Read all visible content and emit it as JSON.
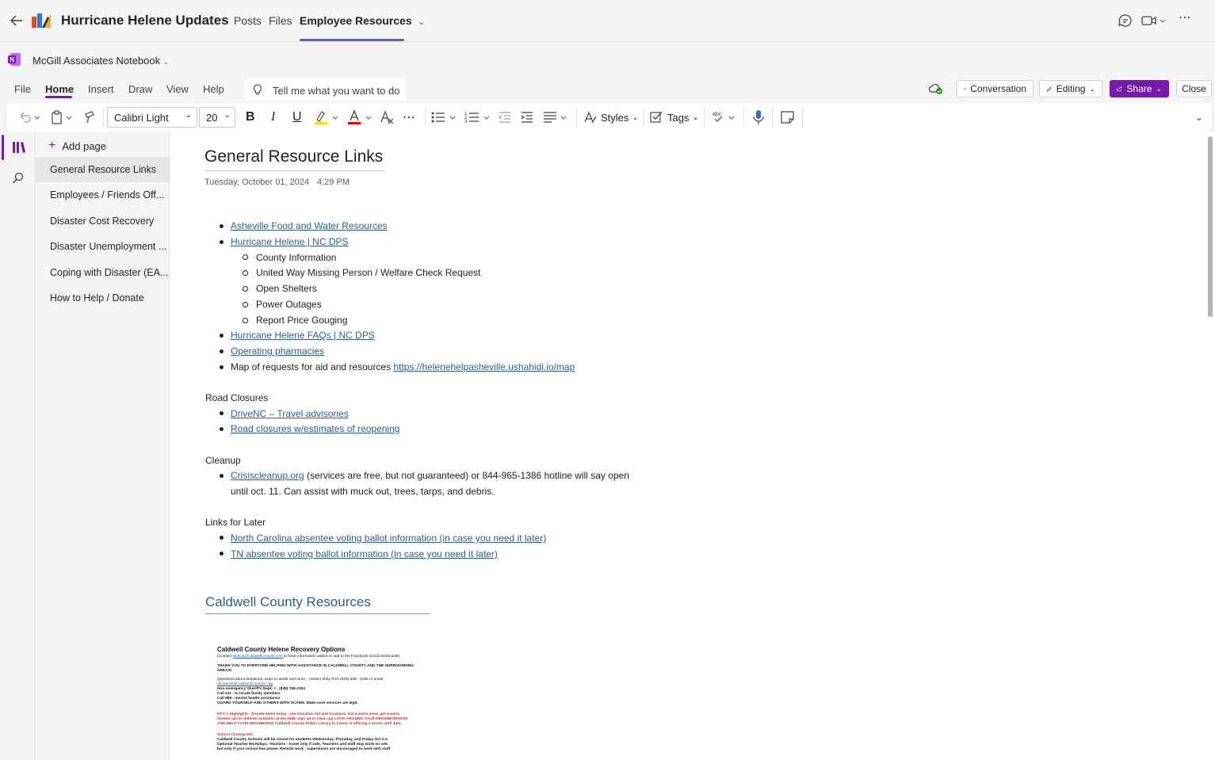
{
  "app": {
    "team_title": "Hurricane Helene Updates",
    "tabs": [
      {
        "label": "Posts"
      },
      {
        "label": "Files"
      },
      {
        "label": "Employee Resources"
      }
    ]
  },
  "notebook": {
    "name": "McGill Associates Notebook"
  },
  "menu": {
    "items": [
      "File",
      "Home",
      "Insert",
      "Draw",
      "View",
      "Help"
    ],
    "tell_me_placeholder": "Tell me what you want to do"
  },
  "actions": {
    "conversation": "Conversation",
    "editing": "Editing",
    "share": "Share",
    "close": "Close"
  },
  "ribbon": {
    "font_name": "Calibri Light",
    "font_size": "20",
    "styles_label": "Styles",
    "tags_label": "Tags",
    "highlight_color": "#ffe000",
    "font_color": "#e00000"
  },
  "pages": {
    "add_page": "Add page",
    "items": [
      "General Resource Links",
      "Employees / Friends Off...",
      "Disaster Cost Recovery",
      "Disaster Unemployment ...",
      "Coping with Disaster (EA...",
      "How to Help / Donate"
    ]
  },
  "page": {
    "title": "General Resource Links",
    "date": "Tuesday, October 01, 2024",
    "time": "4:29 PM",
    "links1": [
      "Asheville Food and Water Resources",
      "Hurricane Helene | NC DPS"
    ],
    "sub_items": [
      "County Information",
      "United Way Missing Person / Welfare Check Request",
      "Open Shelters",
      "Power Outages",
      "Report Price Gouging"
    ],
    "links2": [
      "Hurricane Helene FAQs | NC DPS",
      "Operating pharmacies"
    ],
    "map_text": "Map of requests for aid and resources",
    "map_link": "https://helenehelpasheville.ushahidi.io/map",
    "road_heading": "Road Closures",
    "road_links": [
      "DriveNC – Travel advisories",
      "Road closures w/estimates of reopening"
    ],
    "cleanup_heading": "Cleanup",
    "cleanup_link": "Crisiscleanup.org",
    "cleanup_text1": " (services are free, but not guaranteed) or 844-965-1386 hotline will say open",
    "cleanup_text2": "until oct. 11. Can assist with muck out, trees, tarps, and debris.",
    "later_heading": "Links for Later",
    "later_links": [
      "North Carolina absentee voting ballot information (in case you need it later)",
      "TN absentee voting ballot information (in case you need it later)"
    ],
    "section2_title": "Caldwell County Resources",
    "flyer": {
      "title": "Caldwell County Helene Recovery Options",
      "contact_pre": "(Contact ",
      "contact_email": "sbolick@caldwellschools.com",
      "contact_post": " to have information added or add to the Facebook social media post)",
      "thanks1": "THANK YOU TO EVERYONE HELPING WITH ASSISTANCE IN CALDWELL COUNTY AND THE SURROUNDING",
      "thanks2": "AREAS!",
      "donations": "Questions about donations, ways to assist and more - contact Abby Rich (828) 838 - 0196 or email",
      "donations_email": "donations@caldwellcountync.org",
      "sheriff": "Non-emergency Sheriff's Dept. # - (828) 758-2324",
      "call211": "Call 211 - to locate family members",
      "call988": "Call 988 - mental health assistance",
      "guard": "GUARD YOURSELF AND OTHERS WITH SCAMS. Make sure services are legit.",
      "highlight1": "OCT 1 Highlights - Donate items today - see Donation list and locations. Eat a warm meal, get a warm",
      "highlight2": "shower, go to children activities at the HUB, sign up to clean up! LOOK AROUND YOUR NEIGHBORHOOD",
      "highlight3": "AND HELP YOUR NEIGHBORS! Caldwell County Public Library in Lenoir is offering a movie until 4pm.",
      "school_heading": "School Closing Info",
      "school1": "Caldwell County Schools will be closed for students Wednesday, Thursday, and Friday Oct 2-4",
      "school2": "Optional Teacher Workdays. Teachers - travel only if safe. Teachers and staff may work on site,",
      "school3": "but only if your school has power. Remote work - supervisors are encouraged to work with staff"
    }
  }
}
